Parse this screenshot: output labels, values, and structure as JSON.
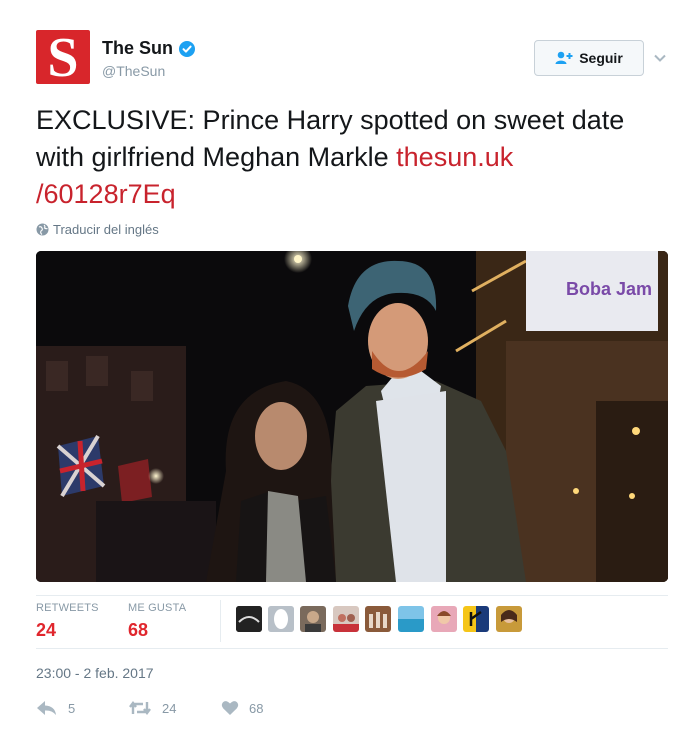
{
  "account": {
    "name": "The Sun",
    "handle": "@TheSun",
    "logo_letter": "S",
    "brand_color": "#d8262b",
    "verified_icon": "verified-badge-icon"
  },
  "follow_button": {
    "label": "Seguir",
    "icon": "add-user-icon"
  },
  "tweet": {
    "text": "EXCLUSIVE: Prince Harry spotted on sweet date with girlfriend Meghan Markle ",
    "link": "thesun.uk /60128r7Eq",
    "link_color": "#c8232d"
  },
  "translate_label": "Traducir del inglés",
  "photo": {
    "sign_text": "Boba Jam"
  },
  "stats": {
    "retweets_label": "RETWEETS",
    "retweets_value": "24",
    "likes_label": "ME GUSTA",
    "likes_value": "68"
  },
  "timestamp": "23:00 - 2 feb. 2017",
  "actions": {
    "reply_count": "5",
    "retweet_count": "24",
    "like_count": "68"
  }
}
